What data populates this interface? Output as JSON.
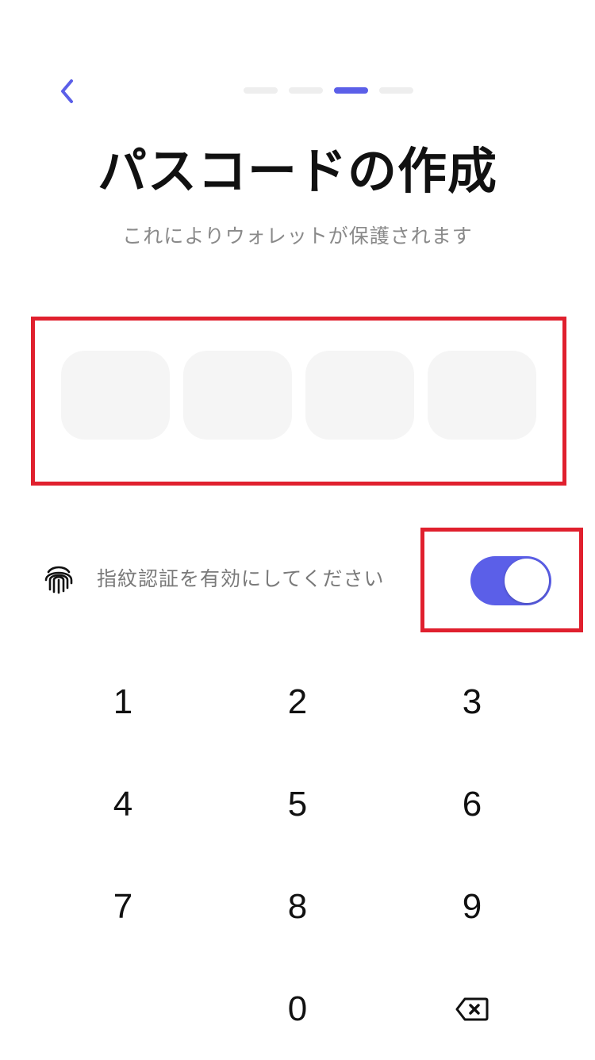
{
  "header": {
    "back_icon": "chevron-left-icon",
    "steps_total": 4,
    "steps_current": 3,
    "accent_color": "#5b5fe8"
  },
  "title": "パスコードの作成",
  "subtitle": "これによりウォレットが保護されます",
  "passcode": {
    "length": 4,
    "digits": [
      "",
      "",
      "",
      ""
    ]
  },
  "biometric": {
    "icon": "fingerprint-icon",
    "label": "指紋認証を有効にしてください",
    "enabled": true
  },
  "keypad": {
    "keys": [
      "1",
      "2",
      "3",
      "4",
      "5",
      "6",
      "7",
      "8",
      "9",
      "",
      "0",
      "backspace"
    ],
    "backspace_icon": "backspace-icon"
  },
  "highlight_color": "#e0202e"
}
